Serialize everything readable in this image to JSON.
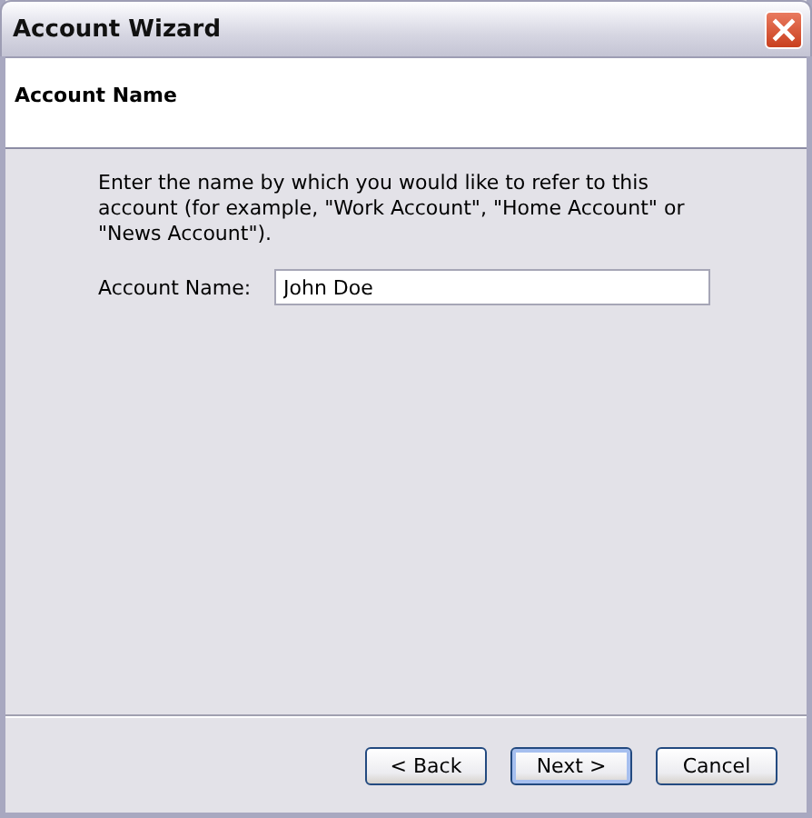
{
  "window": {
    "title": "Account Wizard"
  },
  "header": {
    "title": "Account Name"
  },
  "description": "Enter the name by which you would like to refer to this account (for example, \"Work Account\", \"Home Account\" or \"News Account\").",
  "field": {
    "label": "Account Name:",
    "value": "John Doe"
  },
  "buttons": [
    {
      "label": "< Back",
      "default": false
    },
    {
      "label": "Next >",
      "default": true
    },
    {
      "label": "Cancel",
      "default": false
    }
  ]
}
